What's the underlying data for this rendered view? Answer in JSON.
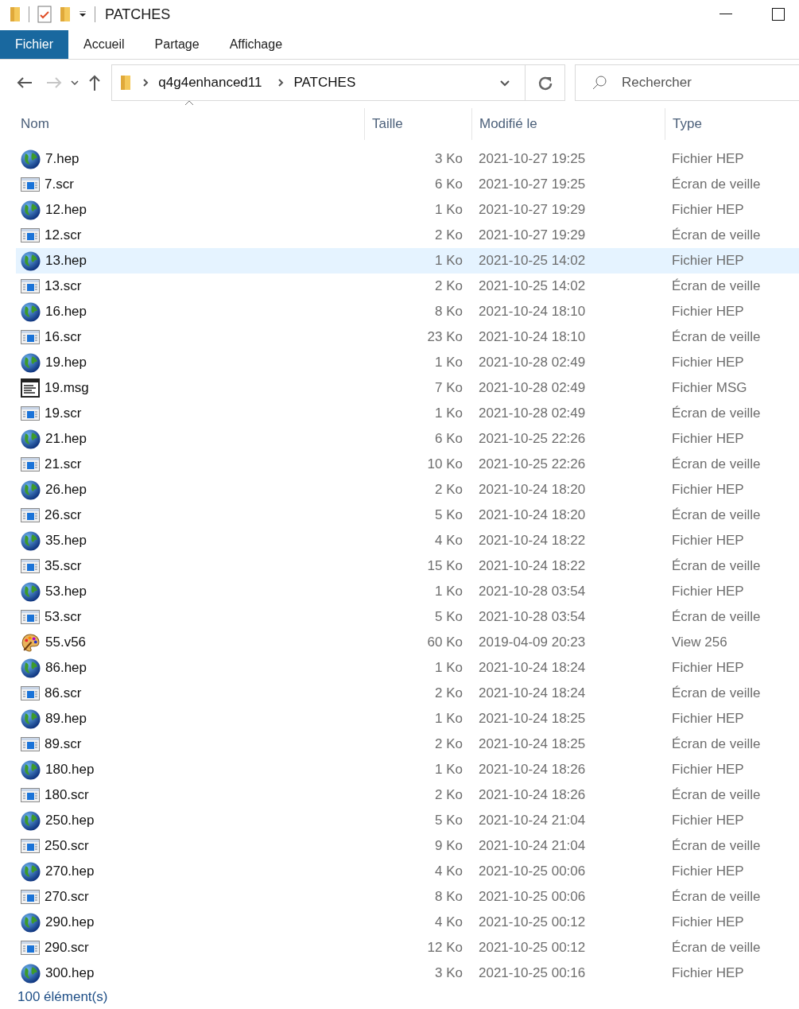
{
  "window": {
    "title": "PATCHES"
  },
  "ribbon_tabs": [
    {
      "label": "Fichier",
      "selected": true
    },
    {
      "label": "Accueil",
      "selected": false
    },
    {
      "label": "Partage",
      "selected": false
    },
    {
      "label": "Affichage",
      "selected": false
    }
  ],
  "address_bar": {
    "path": [
      "q4g4enhanced11",
      "PATCHES"
    ]
  },
  "search": {
    "placeholder": "Rechercher"
  },
  "table": {
    "columns": [
      "Nom",
      "Taille",
      "Modifié le",
      "Type"
    ],
    "rows": [
      {
        "kind": "hep",
        "name": "7.hep",
        "size": "3 Ko",
        "modified": "2021-10-27 19:25",
        "type": "Fichier HEP",
        "selected": false
      },
      {
        "kind": "scr",
        "name": "7.scr",
        "size": "6 Ko",
        "modified": "2021-10-27 19:25",
        "type": "Écran de veille",
        "selected": false
      },
      {
        "kind": "hep",
        "name": "12.hep",
        "size": "1 Ko",
        "modified": "2021-10-27 19:29",
        "type": "Fichier HEP",
        "selected": false
      },
      {
        "kind": "scr",
        "name": "12.scr",
        "size": "2 Ko",
        "modified": "2021-10-27 19:29",
        "type": "Écran de veille",
        "selected": false
      },
      {
        "kind": "hep",
        "name": "13.hep",
        "size": "1 Ko",
        "modified": "2021-10-25 14:02",
        "type": "Fichier HEP",
        "selected": true
      },
      {
        "kind": "scr",
        "name": "13.scr",
        "size": "2 Ko",
        "modified": "2021-10-25 14:02",
        "type": "Écran de veille",
        "selected": false
      },
      {
        "kind": "hep",
        "name": "16.hep",
        "size": "8 Ko",
        "modified": "2021-10-24 18:10",
        "type": "Fichier HEP",
        "selected": false
      },
      {
        "kind": "scr",
        "name": "16.scr",
        "size": "23 Ko",
        "modified": "2021-10-24 18:10",
        "type": "Écran de veille",
        "selected": false
      },
      {
        "kind": "hep",
        "name": "19.hep",
        "size": "1 Ko",
        "modified": "2021-10-28 02:49",
        "type": "Fichier HEP",
        "selected": false
      },
      {
        "kind": "msg",
        "name": "19.msg",
        "size": "7 Ko",
        "modified": "2021-10-28 02:49",
        "type": "Fichier MSG",
        "selected": false
      },
      {
        "kind": "scr",
        "name": "19.scr",
        "size": "1 Ko",
        "modified": "2021-10-28 02:49",
        "type": "Écran de veille",
        "selected": false
      },
      {
        "kind": "hep",
        "name": "21.hep",
        "size": "6 Ko",
        "modified": "2021-10-25 22:26",
        "type": "Fichier HEP",
        "selected": false
      },
      {
        "kind": "scr",
        "name": "21.scr",
        "size": "10 Ko",
        "modified": "2021-10-25 22:26",
        "type": "Écran de veille",
        "selected": false
      },
      {
        "kind": "hep",
        "name": "26.hep",
        "size": "2 Ko",
        "modified": "2021-10-24 18:20",
        "type": "Fichier HEP",
        "selected": false
      },
      {
        "kind": "scr",
        "name": "26.scr",
        "size": "5 Ko",
        "modified": "2021-10-24 18:20",
        "type": "Écran de veille",
        "selected": false
      },
      {
        "kind": "hep",
        "name": "35.hep",
        "size": "4 Ko",
        "modified": "2021-10-24 18:22",
        "type": "Fichier HEP",
        "selected": false
      },
      {
        "kind": "scr",
        "name": "35.scr",
        "size": "15 Ko",
        "modified": "2021-10-24 18:22",
        "type": "Écran de veille",
        "selected": false
      },
      {
        "kind": "hep",
        "name": "53.hep",
        "size": "1 Ko",
        "modified": "2021-10-28 03:54",
        "type": "Fichier HEP",
        "selected": false
      },
      {
        "kind": "scr",
        "name": "53.scr",
        "size": "5 Ko",
        "modified": "2021-10-28 03:54",
        "type": "Écran de veille",
        "selected": false
      },
      {
        "kind": "v56",
        "name": "55.v56",
        "size": "60 Ko",
        "modified": "2019-04-09 20:23",
        "type": "View 256",
        "selected": false
      },
      {
        "kind": "hep",
        "name": "86.hep",
        "size": "1 Ko",
        "modified": "2021-10-24 18:24",
        "type": "Fichier HEP",
        "selected": false
      },
      {
        "kind": "scr",
        "name": "86.scr",
        "size": "2 Ko",
        "modified": "2021-10-24 18:24",
        "type": "Écran de veille",
        "selected": false
      },
      {
        "kind": "hep",
        "name": "89.hep",
        "size": "1 Ko",
        "modified": "2021-10-24 18:25",
        "type": "Fichier HEP",
        "selected": false
      },
      {
        "kind": "scr",
        "name": "89.scr",
        "size": "2 Ko",
        "modified": "2021-10-24 18:25",
        "type": "Écran de veille",
        "selected": false
      },
      {
        "kind": "hep",
        "name": "180.hep",
        "size": "1 Ko",
        "modified": "2021-10-24 18:26",
        "type": "Fichier HEP",
        "selected": false
      },
      {
        "kind": "scr",
        "name": "180.scr",
        "size": "2 Ko",
        "modified": "2021-10-24 18:26",
        "type": "Écran de veille",
        "selected": false
      },
      {
        "kind": "hep",
        "name": "250.hep",
        "size": "5 Ko",
        "modified": "2021-10-24 21:04",
        "type": "Fichier HEP",
        "selected": false
      },
      {
        "kind": "scr",
        "name": "250.scr",
        "size": "9 Ko",
        "modified": "2021-10-24 21:04",
        "type": "Écran de veille",
        "selected": false
      },
      {
        "kind": "hep",
        "name": "270.hep",
        "size": "4 Ko",
        "modified": "2021-10-25 00:06",
        "type": "Fichier HEP",
        "selected": false
      },
      {
        "kind": "scr",
        "name": "270.scr",
        "size": "8 Ko",
        "modified": "2021-10-25 00:06",
        "type": "Écran de veille",
        "selected": false
      },
      {
        "kind": "hep",
        "name": "290.hep",
        "size": "4 Ko",
        "modified": "2021-10-25 00:12",
        "type": "Fichier HEP",
        "selected": false
      },
      {
        "kind": "scr",
        "name": "290.scr",
        "size": "12 Ko",
        "modified": "2021-10-25 00:12",
        "type": "Écran de veille",
        "selected": false
      },
      {
        "kind": "hep",
        "name": "300.hep",
        "size": "3 Ko",
        "modified": "2021-10-25 00:16",
        "type": "Fichier HEP",
        "selected": false
      }
    ]
  },
  "status_bar": {
    "count": "100 élément(s)"
  }
}
